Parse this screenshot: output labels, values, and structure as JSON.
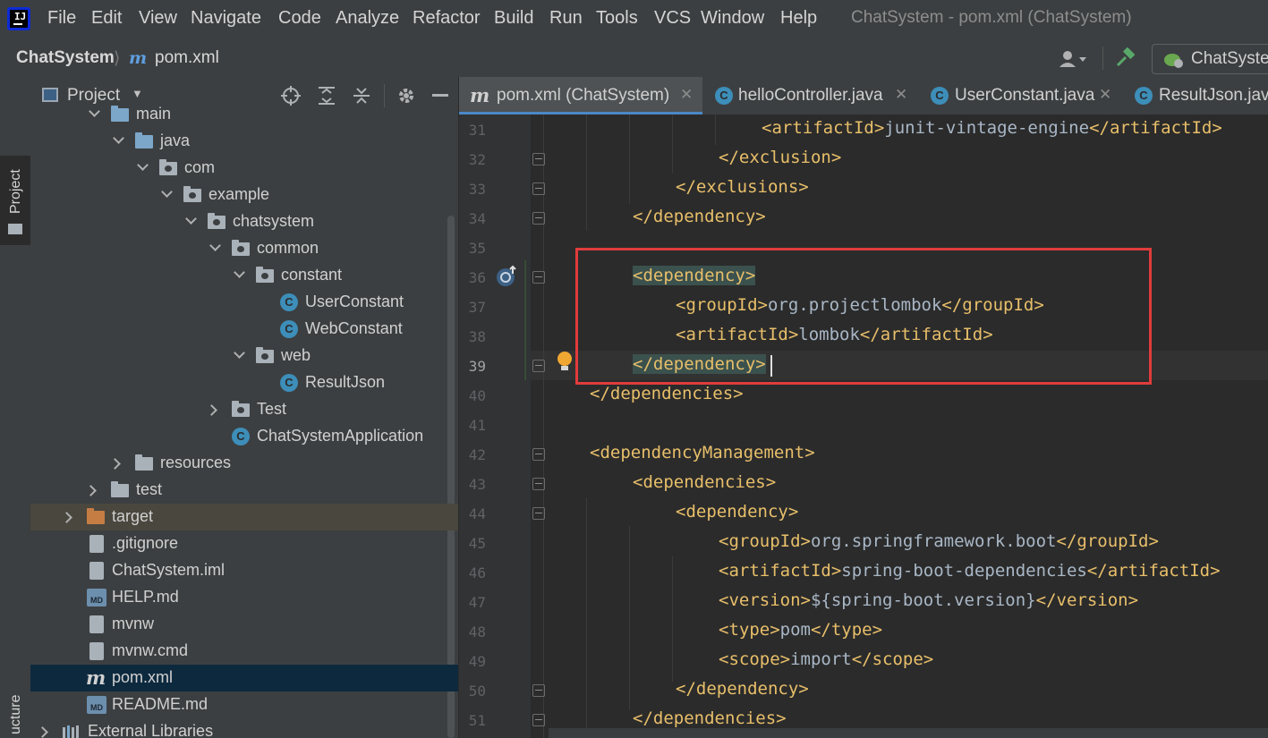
{
  "menubar": {
    "items": [
      "File",
      "Edit",
      "View",
      "Navigate",
      "Code",
      "Analyze",
      "Refactor",
      "Build",
      "Run",
      "Tools",
      "VCS",
      "Window",
      "Help"
    ],
    "window_title": "ChatSystem - pom.xml (ChatSystem)"
  },
  "navbar": {
    "project": "ChatSystem",
    "file_icon_letter": "m",
    "file": "pom.xml",
    "run_config": "ChatSyste"
  },
  "stripe": {
    "project_tab": "Project",
    "structure_tab": "ucture"
  },
  "project_panel": {
    "title": "Project",
    "tree": [
      {
        "label": "main",
        "icon": "folder"
      },
      {
        "label": "java",
        "icon": "folder-source"
      },
      {
        "label": "com",
        "icon": "package"
      },
      {
        "label": "example",
        "icon": "package"
      },
      {
        "label": "chatsystem",
        "icon": "package"
      },
      {
        "label": "common",
        "icon": "package"
      },
      {
        "label": "constant",
        "icon": "package"
      },
      {
        "label": "UserConstant",
        "icon": "class-icon"
      },
      {
        "label": "WebConstant",
        "icon": "class-icon"
      },
      {
        "label": "web",
        "icon": "package"
      },
      {
        "label": "ResultJson",
        "icon": "class-icon"
      },
      {
        "label": "Test",
        "icon": "package"
      },
      {
        "label": "ChatSystemApplication",
        "icon": "spring-boot-app-icon"
      },
      {
        "label": "resources",
        "icon": "resources-folder"
      },
      {
        "label": "test",
        "icon": "folder"
      },
      {
        "label": "target",
        "icon": "excluded-folder"
      },
      {
        "label": ".gitignore",
        "icon": "gitignore-file-icon"
      },
      {
        "label": "ChatSystem.iml",
        "icon": "iml-file-icon"
      },
      {
        "label": "HELP.md",
        "icon": "markdown-file-icon"
      },
      {
        "label": "mvnw",
        "icon": "shell-file-icon"
      },
      {
        "label": "mvnw.cmd",
        "icon": "text-file-icon"
      },
      {
        "label": "pom.xml",
        "icon": "maven-file-icon",
        "selected": true
      },
      {
        "label": "README.md",
        "icon": "markdown-file-icon"
      },
      {
        "label": "External Libraries",
        "icon": "libraries-icon"
      }
    ],
    "class_letter": "C",
    "md_letters": "MD"
  },
  "tabs": [
    {
      "label": "pom.xml (ChatSystem)",
      "active": true
    },
    {
      "label": "helloController.java"
    },
    {
      "label": "UserConstant.java"
    },
    {
      "label": "ResultJson.java"
    }
  ],
  "editor": {
    "lines": [
      {
        "n": "31",
        "text": "<artifactId>junit-vintage-engine</artifactId>"
      },
      {
        "n": "32",
        "text": "</exclusion>"
      },
      {
        "n": "33",
        "text": "</exclusions>"
      },
      {
        "n": "34",
        "text": "</dependency>"
      },
      {
        "n": "35",
        "text": ""
      },
      {
        "n": "36",
        "text": "<dependency>"
      },
      {
        "n": "37",
        "text": "<groupId>org.projectlombok</groupId>"
      },
      {
        "n": "38",
        "text": "<artifactId>lombok</artifactId>"
      },
      {
        "n": "39",
        "text": "</dependency>"
      },
      {
        "n": "40",
        "text": "</dependencies>"
      },
      {
        "n": "41",
        "text": ""
      },
      {
        "n": "42",
        "text": "<dependencyManagement>"
      },
      {
        "n": "43",
        "text": "<dependencies>"
      },
      {
        "n": "44",
        "text": "<dependency>"
      },
      {
        "n": "45",
        "text": "<groupId>org.springframework.boot</groupId>"
      },
      {
        "n": "46",
        "text": "<artifactId>spring-boot-dependencies</artifactId>"
      },
      {
        "n": "47",
        "text": "<version>${spring-boot.version}</version>"
      },
      {
        "n": "48",
        "text": "<type>pom</type>"
      },
      {
        "n": "49",
        "text": "<scope>import</scope>"
      },
      {
        "n": "50",
        "text": "</dependency>"
      },
      {
        "n": "51",
        "text": "</dependencies>"
      }
    ],
    "highlight_box_color": "#e03c3c"
  }
}
